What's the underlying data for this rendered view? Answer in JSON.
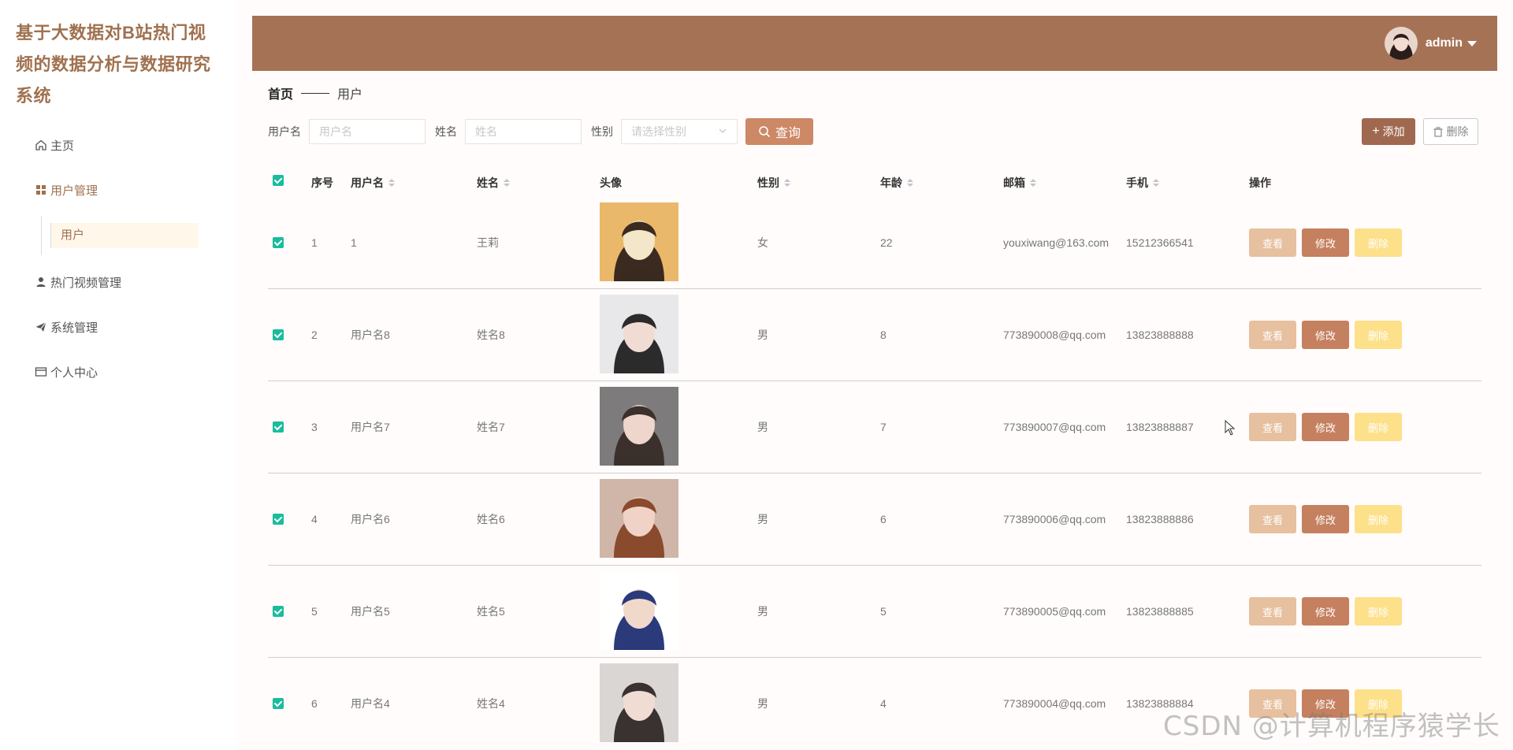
{
  "app": {
    "title": "基于大数据对B站热门视频的数据分析与数据研究系统"
  },
  "sidebar": {
    "home": "主页",
    "user_mgmt": "用户管理",
    "user_sub": "用户",
    "video_mgmt": "热门视频管理",
    "system_mgmt": "系统管理",
    "personal_center": "个人中心"
  },
  "topbar": {
    "username": "admin"
  },
  "breadcrumb": {
    "home": "首页",
    "current": "用户"
  },
  "search": {
    "username_label": "用户名",
    "username_placeholder": "用户名",
    "name_label": "姓名",
    "name_placeholder": "姓名",
    "gender_label": "性别",
    "gender_placeholder": "请选择性别",
    "query_button": "查询"
  },
  "toolbar": {
    "add_button": "添加",
    "delete_button": "删除"
  },
  "table": {
    "headers": {
      "index": "序号",
      "username": "用户名",
      "name": "姓名",
      "avatar": "头像",
      "gender": "性别",
      "age": "年龄",
      "email": "邮箱",
      "phone": "手机",
      "actions": "操作"
    },
    "action_labels": {
      "view": "查看",
      "edit": "修改",
      "delete": "删除"
    },
    "rows": [
      {
        "index": "1",
        "username": "1",
        "name": "王莉",
        "gender": "女",
        "age": "22",
        "email": "youxiwang@163.com",
        "phone": "15212366541",
        "avatar_colors": [
          "#e9b86a",
          "#f4e6c8",
          "#3a2a20"
        ]
      },
      {
        "index": "2",
        "username": "用户名8",
        "name": "姓名8",
        "gender": "男",
        "age": "8",
        "email": "773890008@qq.com",
        "phone": "13823888888",
        "avatar_colors": [
          "#e8e8ea",
          "#f1dcd3",
          "#2b2b2b"
        ]
      },
      {
        "index": "3",
        "username": "用户名7",
        "name": "姓名7",
        "gender": "男",
        "age": "7",
        "email": "773890007@qq.com",
        "phone": "13823888887",
        "avatar_colors": [
          "#7d7b7b",
          "#eed6cc",
          "#3b302c"
        ]
      },
      {
        "index": "4",
        "username": "用户名6",
        "name": "姓名6",
        "gender": "男",
        "age": "6",
        "email": "773890006@qq.com",
        "phone": "13823888886",
        "avatar_colors": [
          "#cfb6a8",
          "#f0d3c6",
          "#8a4a2d"
        ]
      },
      {
        "index": "5",
        "username": "用户名5",
        "name": "姓名5",
        "gender": "男",
        "age": "5",
        "email": "773890005@qq.com",
        "phone": "13823888885",
        "avatar_colors": [
          "#ffffff",
          "#f0d8cb",
          "#2a3a7a"
        ]
      },
      {
        "index": "6",
        "username": "用户名4",
        "name": "姓名4",
        "gender": "男",
        "age": "4",
        "email": "773890004@qq.com",
        "phone": "13823888884",
        "avatar_colors": [
          "#d9d6d4",
          "#f1dcd4",
          "#3a3230"
        ]
      }
    ]
  },
  "watermark": "CSDN @计算机程序猿学长"
}
